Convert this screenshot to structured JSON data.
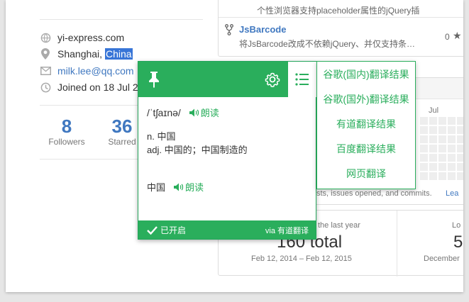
{
  "profile": {
    "website": "yi-express.com",
    "location_prefix": "Shanghai, ",
    "location_highlight": "China",
    "email": "milk.lee@qq.com",
    "joined": "Joined on 18 Jul 2",
    "stats": [
      {
        "value": "8",
        "label": "Followers"
      },
      {
        "value": "36",
        "label": "Starred"
      }
    ]
  },
  "repos": {
    "top_desc": "个性浏览器支持placeholder属性的jQuery插",
    "jsbarcode_name": "JsBarcode",
    "jsbarcode_desc": "将JsBarcode改成不依赖jQuery、并仅支持条…",
    "star_count": "0"
  },
  "contrib": {
    "month": "Jul",
    "legend_text": "sts, issues opened, and commits.",
    "legend_link": "Lea",
    "last_year_label": "the last year",
    "total": "160 total",
    "range": "Feb 12, 2014 – Feb 12, 2015",
    "longest_label": "Lo",
    "longest_value": "5",
    "longest_range": "December"
  },
  "popup": {
    "phonetic": "/ˈtʃaɪnə/",
    "speak_label": "朗读",
    "definitions": [
      "n. 中国",
      "adj. 中国的；中国制造的"
    ],
    "word": "中国",
    "enabled_label": "已开启",
    "via_label": "via 有道翻译"
  },
  "menu": {
    "items": [
      "谷歌(国内)翻译结果",
      "谷歌(国外)翻译结果",
      "有道翻译结果",
      "百度翻译结果",
      "网页翻译"
    ]
  },
  "colors": {
    "accent": "#2aae5c",
    "link": "#4078c0",
    "highlight": "#3875d7"
  }
}
